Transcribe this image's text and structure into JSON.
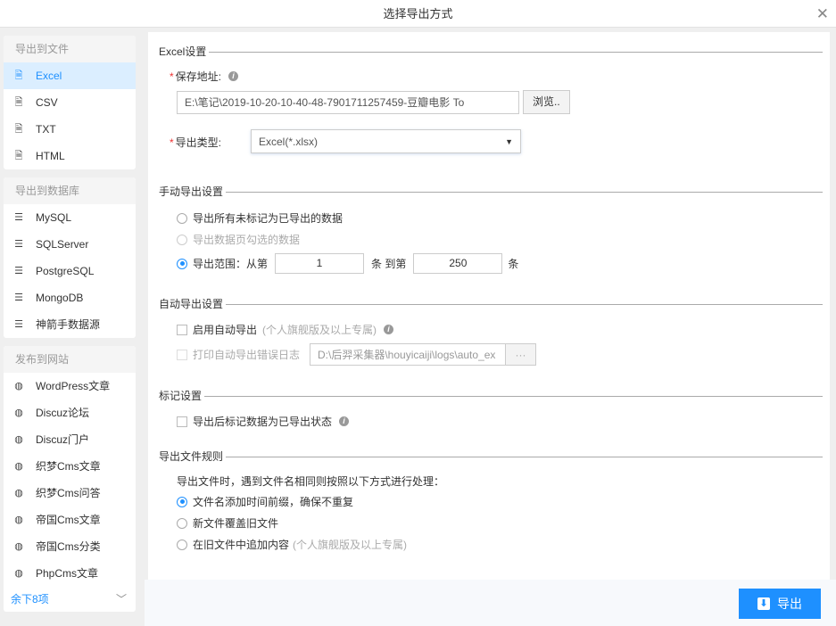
{
  "title": "选择导出方式",
  "sidebar": {
    "groups": [
      {
        "header": "导出到文件",
        "items": [
          {
            "label": "Excel",
            "icon": "file-icon"
          },
          {
            "label": "CSV",
            "icon": "file-icon"
          },
          {
            "label": "TXT",
            "icon": "file-icon"
          },
          {
            "label": "HTML",
            "icon": "file-icon"
          }
        ]
      },
      {
        "header": "导出到数据库",
        "items": [
          {
            "label": "MySQL",
            "icon": "database-icon"
          },
          {
            "label": "SQLServer",
            "icon": "database-icon"
          },
          {
            "label": "PostgreSQL",
            "icon": "database-icon"
          },
          {
            "label": "MongoDB",
            "icon": "database-icon"
          },
          {
            "label": "神箭手数据源",
            "icon": "database-icon"
          }
        ]
      },
      {
        "header": "发布到网站",
        "items": [
          {
            "label": "WordPress文章",
            "icon": "globe-icon"
          },
          {
            "label": "Discuz论坛",
            "icon": "globe-icon"
          },
          {
            "label": "Discuz门户",
            "icon": "globe-icon"
          },
          {
            "label": "织梦Cms文章",
            "icon": "globe-icon"
          },
          {
            "label": "织梦Cms问答",
            "icon": "globe-icon"
          },
          {
            "label": "帝国Cms文章",
            "icon": "globe-icon"
          },
          {
            "label": "帝国Cms分类",
            "icon": "globe-icon"
          },
          {
            "label": "PhpCms文章",
            "icon": "globe-icon"
          }
        ]
      }
    ],
    "more": "余下8项"
  },
  "excel": {
    "section": "Excel设置",
    "path_label": "保存地址:",
    "path_value": "E:\\笔记\\2019-10-20-10-40-48-7901711257459-豆瓣电影 To",
    "browse": "浏览..",
    "type_label": "导出类型:",
    "type_value": "Excel(*.xlsx)"
  },
  "manual": {
    "section": "手动导出设置",
    "opt_all": "导出所有未标记为已导出的数据",
    "opt_checked": "导出数据页勾选的数据",
    "opt_range": "导出范围：从第",
    "from": "1",
    "unit1": "条  到第",
    "to": "250",
    "unit2": "条"
  },
  "auto": {
    "section": "自动导出设置",
    "enable": "启用自动导出",
    "enable_note": "(个人旗舰版及以上专属)",
    "log": "打印自动导出错误日志",
    "log_path": "D:\\后羿采集器\\houyicaiji\\logs\\auto_ex",
    "log_btn": "···"
  },
  "mark": {
    "section": "标记设置",
    "label": "导出后标记数据为已导出状态"
  },
  "rules": {
    "section": "导出文件规则",
    "desc": "导出文件时，遇到文件名相同则按照以下方式进行处理：",
    "opt1": "文件名添加时间前缀，确保不重复",
    "opt2": "新文件覆盖旧文件",
    "opt3": "在旧文件中追加内容",
    "opt3_note": "(个人旗舰版及以上专属)"
  },
  "export_button": "导出",
  "colors": {
    "accent": "#1e90ff"
  }
}
